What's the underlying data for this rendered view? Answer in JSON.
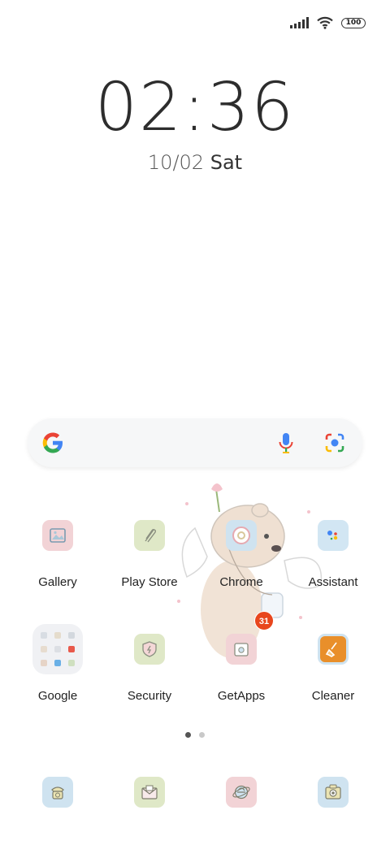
{
  "status": {
    "battery": "100",
    "icons": [
      "signal-icon",
      "wifi-icon",
      "battery-icon"
    ]
  },
  "clock": {
    "time": "02:36"
  },
  "date": {
    "day": "10/02",
    "weekday": "Sat"
  },
  "search": {
    "icons": [
      "google-logo-icon",
      "microphone-icon",
      "google-lens-icon"
    ]
  },
  "apps": [
    {
      "label": "Gallery",
      "icon": "gallery-icon",
      "color": "#f2d3d6"
    },
    {
      "label": "Play Store",
      "icon": "play-store-icon",
      "color": "#dfe8c7"
    },
    {
      "label": "Chrome",
      "icon": "chrome-icon",
      "color": "#cfe3f0"
    },
    {
      "label": "Assistant",
      "icon": "assistant-icon",
      "color": "#d2e6f3"
    },
    {
      "label": "Google",
      "icon": "google-folder-icon"
    },
    {
      "label": "Security",
      "icon": "security-icon",
      "color": "#dfe8c7"
    },
    {
      "label": "GetApps",
      "icon": "getapps-icon",
      "color": "#f2d3d6",
      "badge": "31"
    },
    {
      "label": "Cleaner",
      "icon": "cleaner-icon",
      "color": "#e98f2a"
    }
  ],
  "dock": [
    {
      "icon": "phone-icon",
      "color": "#cfe3f0"
    },
    {
      "icon": "messages-icon",
      "color": "#dfe8c7"
    },
    {
      "icon": "browser-icon",
      "color": "#f2d3d6"
    },
    {
      "icon": "camera-icon",
      "color": "#cfe3f0"
    }
  ],
  "pages": {
    "count": 2,
    "current": 1
  }
}
